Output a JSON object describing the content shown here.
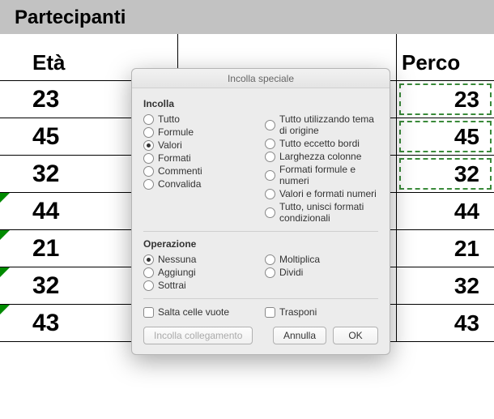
{
  "header": {
    "title": "Partecipanti"
  },
  "columns": {
    "left": "Età",
    "right": "Perco"
  },
  "rows": [
    {
      "left": "23",
      "right": "23",
      "tri": false,
      "paste": true
    },
    {
      "left": "45",
      "right": "45",
      "tri": false,
      "paste": true
    },
    {
      "left": "32",
      "right": "32",
      "tri": false,
      "paste": true
    },
    {
      "left": "44",
      "right": "44",
      "tri": true,
      "paste": false
    },
    {
      "left": "21",
      "right": "21",
      "tri": true,
      "paste": false
    },
    {
      "left": "32",
      "right": "32",
      "tri": true,
      "paste": false
    },
    {
      "left": "43",
      "right": "43",
      "tri": true,
      "paste": false
    }
  ],
  "dialog": {
    "title": "Incolla speciale",
    "paste_label": "Incolla",
    "paste_left": [
      "Tutto",
      "Formule",
      "Valori",
      "Formati",
      "Commenti",
      "Convalida"
    ],
    "paste_right": [
      "Tutto utilizzando tema di origine",
      "Tutto eccetto bordi",
      "Larghezza colonne",
      "Formati formule e numeri",
      "Valori e formati numeri",
      "Tutto, unisci formati condizionali"
    ],
    "paste_selected": "Valori",
    "op_label": "Operazione",
    "op_left": [
      "Nessuna",
      "Aggiungi",
      "Sottrai"
    ],
    "op_right": [
      "Moltiplica",
      "Dividi"
    ],
    "op_selected": "Nessuna",
    "skip_blanks": "Salta celle vuote",
    "transpose": "Trasponi",
    "paste_link": "Incolla collegamento",
    "cancel": "Annulla",
    "ok": "OK"
  }
}
